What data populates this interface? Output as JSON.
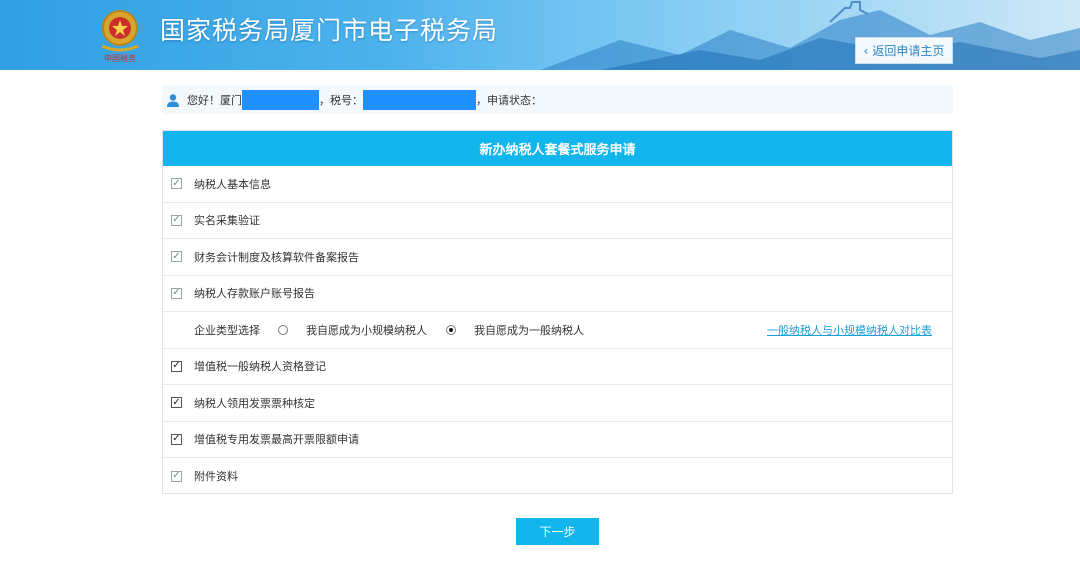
{
  "header": {
    "title": "国家税务局厦门市电子税务局",
    "back_label": "返回申请主页",
    "emblem_icon": "tax-emblem-icon",
    "emblem_caption": "中国税务"
  },
  "userbar": {
    "greeting": "您好！厦门",
    "tax_no_label": "，税号：",
    "status_label": "，申请状态：",
    "user_icon": "user-icon",
    "redaction_color": "#1e90ff"
  },
  "form": {
    "title": "新办纳税人套餐式服务申请",
    "items_top": [
      {
        "label": "纳税人基本信息",
        "checked": true
      },
      {
        "label": "实名采集验证",
        "checked": true
      },
      {
        "label": "财务会计制度及核算软件备案报告",
        "checked": true
      },
      {
        "label": "纳税人存款账户账号报告",
        "checked": true
      }
    ],
    "enterprise_type": {
      "label": "企业类型选择",
      "options": [
        {
          "label": "我自愿成为小规模纳税人",
          "selected": false
        },
        {
          "label": "我自愿成为一般纳税人",
          "selected": true
        }
      ],
      "compare_link": "一般纳税人与小规模纳税人对比表"
    },
    "items_bottom": [
      {
        "label": "增值税一般纳税人资格登记",
        "checked": true
      },
      {
        "label": "纳税人领用发票票种核定",
        "checked": true
      },
      {
        "label": "增值税专用发票最高开票限额申请",
        "checked": true
      },
      {
        "label": "附件资料",
        "checked": true
      }
    ]
  },
  "next_label": "下一步",
  "colors": {
    "accent": "#12b5ec",
    "link": "#1c9ed6",
    "banner_start": "#2f9fe3"
  }
}
